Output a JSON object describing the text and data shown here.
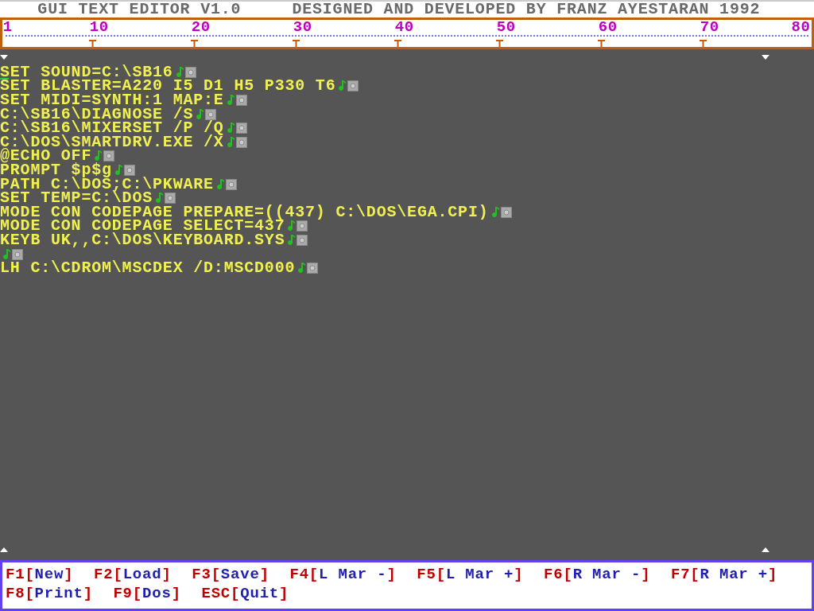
{
  "title_bar": {
    "app": "GUI TEXT EDITOR V1.0",
    "credit": "DESIGNED AND DEVELOPED BY FRANZ AYESTARAN 1992"
  },
  "ruler": {
    "marks": [
      "1",
      "10",
      "20",
      "30",
      "40",
      "50",
      "60",
      "70",
      "80"
    ]
  },
  "editor": {
    "lines": [
      {
        "kind": "text",
        "text": "SET SOUND=C:\\SB16"
      },
      {
        "kind": "text",
        "text": "SET BLASTER=A220 I5 D1 H5 P330 T6"
      },
      {
        "kind": "text",
        "text": "SET MIDI=SYNTH:1 MAP:E"
      },
      {
        "kind": "text",
        "text": "C:\\SB16\\DIAGNOSE /S"
      },
      {
        "kind": "text",
        "text": "C:\\SB16\\MIXERSET /P /Q"
      },
      {
        "kind": "text",
        "text": "C:\\DOS\\SMARTDRV.EXE /X"
      },
      {
        "kind": "text",
        "text": "@ECHO OFF"
      },
      {
        "kind": "text",
        "text": "PROMPT $p$g"
      },
      {
        "kind": "text",
        "text": "PATH C:\\DOS;C:\\PKWARE"
      },
      {
        "kind": "text",
        "text": "SET TEMP=C:\\DOS"
      },
      {
        "kind": "text",
        "text": "MODE CON CODEPAGE PREPARE=((437) C:\\DOS\\EGA.CPI)"
      },
      {
        "kind": "text",
        "text": "MODE CON CODEPAGE SELECT=437"
      },
      {
        "kind": "text",
        "text": "KEYB UK,,C:\\DOS\\KEYBOARD.SYS"
      },
      {
        "kind": "blank"
      },
      {
        "kind": "text",
        "text": "LH C:\\CDROM\\MSCDEX /D:MSCD000"
      }
    ]
  },
  "shortcuts": [
    {
      "key": "F1[",
      "label": "New",
      "close": "]"
    },
    {
      "key": "F2[",
      "label": "Load",
      "close": "]"
    },
    {
      "key": "F3[",
      "label": "Save",
      "close": "]"
    },
    {
      "key": "F4[",
      "label": "L Mar -",
      "close": "]"
    },
    {
      "key": "F5[",
      "label": "L Mar +",
      "close": "]"
    },
    {
      "key": "F6[",
      "label": "R Mar -",
      "close": "]"
    },
    {
      "key": "F7[",
      "label": "R Mar +",
      "close": "]"
    },
    {
      "key": "F8[",
      "label": "Print",
      "close": "]"
    },
    {
      "key": "F9[",
      "label": "Dos",
      "close": "]"
    },
    {
      "key": "ESC[",
      "label": "Quit",
      "close": "]"
    }
  ]
}
